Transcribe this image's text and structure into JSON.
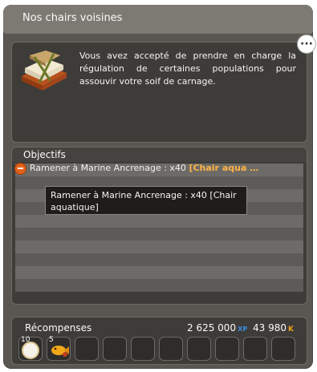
{
  "window": {
    "title": "Nos chairs voisines"
  },
  "description": "Vous avez accepté de prendre en charge la régulation de certaines populations pour assouvir votre soif de carnage.",
  "objectives": {
    "header": "Objectifs",
    "items": [
      {
        "text": "Ramener à Marine Ancrenage : x40 ",
        "highlight": "[Chair aqua …"
      }
    ],
    "tooltip": "Ramener à Marine Ancrenage : x40 [Chair aquatique]"
  },
  "rewards": {
    "title": "Récompenses",
    "xp": "2 625 000",
    "xp_unit": "XP",
    "kamas": "43 980",
    "kamas_unit": "K",
    "items": [
      {
        "icon": "plate-icon",
        "qty": "10"
      },
      {
        "icon": "fish-dish-icon",
        "qty": "5"
      }
    ],
    "empty_slots": 8
  },
  "colors": {
    "highlight": "#ffb347",
    "objective_icon": "#e0611b",
    "xp": "#3a8de0",
    "kamas": "#e8a018"
  }
}
